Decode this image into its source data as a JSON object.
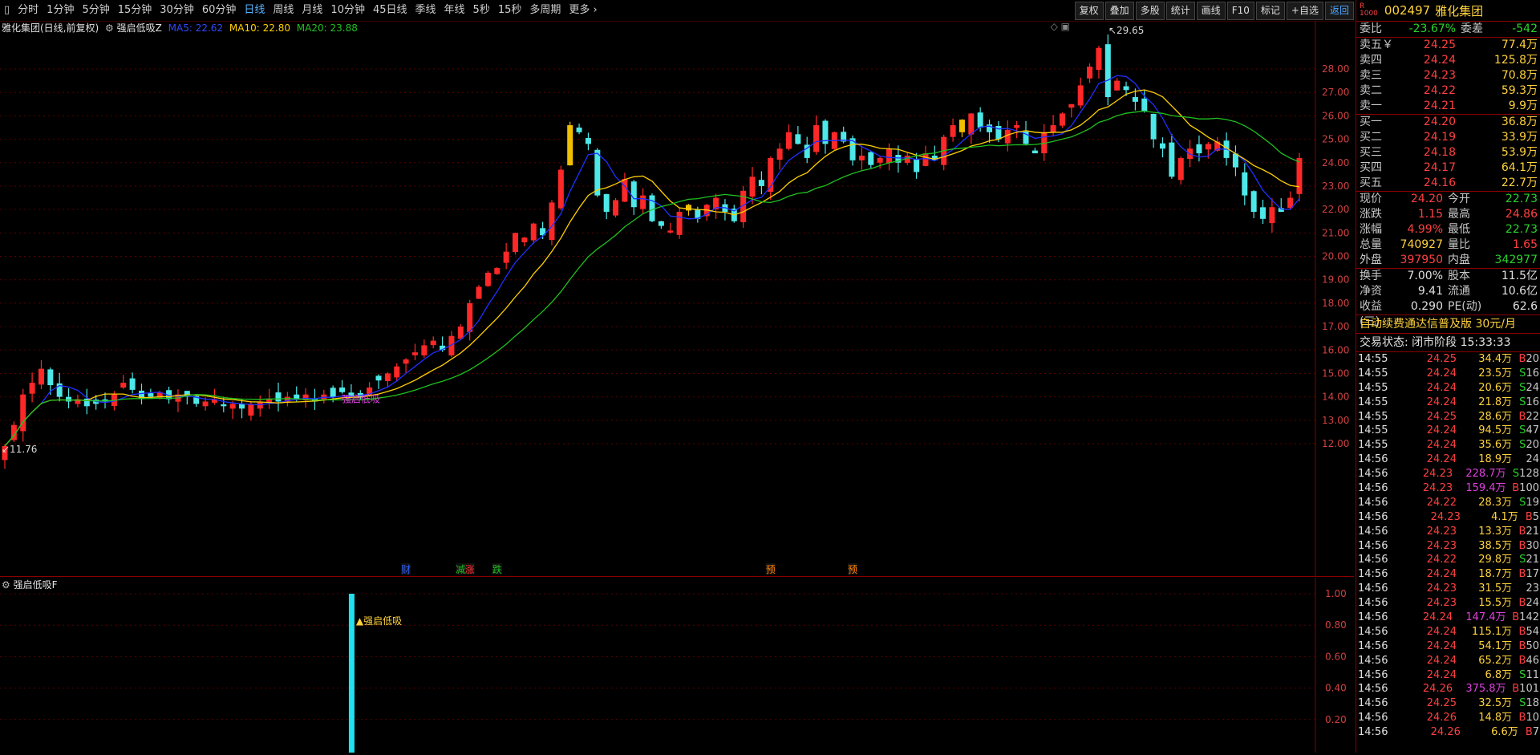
{
  "toolbar": {
    "periods": [
      "分时",
      "1分钟",
      "5分钟",
      "15分钟",
      "30分钟",
      "60分钟",
      "日线",
      "周线",
      "月线",
      "10分钟",
      "45日线",
      "季线",
      "年线",
      "5秒",
      "15秒",
      "多周期",
      "更多"
    ],
    "active_period": "日线",
    "right_buttons": [
      "复权",
      "叠加",
      "多股",
      "统计",
      "画线",
      "F10",
      "标记",
      "+自选",
      "返回"
    ]
  },
  "main_chart": {
    "header_title": "雅化集团(日线,前复权)",
    "indicator_name": "强启低吸Z",
    "ma5_label": "MA5: 22.62",
    "ma10_label": "MA10: 22.80",
    "ma20_label": "MA20: 23.88",
    "high_label": "29.65",
    "low_label": "11.76",
    "signal_text": "强启低吸",
    "event_markers": [
      "财",
      "减",
      "涨",
      "跌",
      "预",
      "预"
    ],
    "y_ticks": [
      "28.00",
      "27.00",
      "26.00",
      "25.00",
      "24.00",
      "23.00",
      "22.00",
      "21.00",
      "20.00",
      "19.00",
      "18.00",
      "17.00",
      "16.00",
      "15.00",
      "14.00",
      "13.00",
      "12.00"
    ]
  },
  "indicator_panel": {
    "title": "强启低吸F",
    "signal_label": "强启低吸",
    "y_ticks": [
      "1.00",
      "0.80",
      "0.60",
      "0.40",
      "0.20"
    ]
  },
  "chart_data": {
    "type": "candlestick",
    "title": "雅化集团(日线,前复权)",
    "ylim": [
      11,
      30
    ],
    "ma_series": [
      {
        "name": "MA5",
        "value": 22.62,
        "color": "#2030ff"
      },
      {
        "name": "MA10",
        "value": 22.8,
        "color": "#ffd000"
      },
      {
        "name": "MA20",
        "value": 23.88,
        "color": "#20c020"
      }
    ],
    "closes": [
      11.9,
      12.8,
      14.1,
      14.6,
      15.2,
      14.5,
      14.0,
      13.8,
      13.9,
      13.6,
      13.7,
      13.8,
      14.1,
      14.6,
      14.3,
      13.9,
      14.0,
      14.2,
      13.9,
      14.1,
      14.0,
      13.7,
      13.8,
      13.9,
      13.6,
      13.7,
      13.5,
      13.7,
      13.8,
      13.9,
      13.8,
      14.0,
      13.9,
      14.1,
      13.8,
      14.1,
      14.0,
      14.2,
      14.0,
      14.0,
      14.4,
      14.7,
      15.0,
      15.3,
      15.6,
      15.9,
      16.2,
      16.4,
      16.0,
      16.6,
      17.0,
      18.0,
      18.7,
      19.3,
      19.5,
      20.2,
      21.0,
      20.8,
      21.4,
      20.9,
      22.3,
      23.7,
      25.6,
      25.3,
      24.8,
      22.6,
      21.9,
      22.4,
      23.3,
      22.1,
      22.6,
      21.5,
      21.3,
      21.1,
      21.9,
      22.2,
      21.6,
      22.2,
      22.5,
      21.9,
      21.5,
      22.8,
      23.4,
      23.0,
      24.2,
      24.6,
      25.3,
      24.8,
      24.2,
      25.6,
      24.8,
      25.3,
      24.9,
      24.1,
      24.3,
      23.9,
      24.2,
      24.6,
      24.0,
      24.3,
      23.6,
      24.4,
      24.1,
      25.1,
      25.6,
      25.3,
      26.1,
      25.5,
      25.3,
      25.0,
      25.4,
      25.6,
      24.8,
      24.4,
      25.3,
      25.6,
      26.1,
      26.5,
      27.3,
      28.1,
      28.9,
      26.8,
      27.5,
      27.1,
      26.6,
      26.2,
      25.0,
      24.6,
      23.4,
      24.2,
      24.6,
      24.4,
      24.8,
      24.9,
      24.2,
      23.8,
      22.6,
      21.9,
      21.6,
      22.1,
      21.9,
      22.5,
      24.2
    ],
    "y_ticks": [
      28,
      27,
      26,
      25,
      24,
      23,
      22,
      21,
      20,
      19,
      18,
      17,
      16,
      15,
      14,
      13,
      12
    ]
  },
  "quote": {
    "code": "002497",
    "name": "雅化集团",
    "ratio_label": "委比",
    "ratio_value": "-23.67%",
    "diff_label": "委差",
    "diff_value": "-542",
    "asks": [
      {
        "label": "卖五￥",
        "price": "24.25",
        "vol": "77.4万"
      },
      {
        "label": "卖四",
        "price": "24.24",
        "vol": "125.8万"
      },
      {
        "label": "卖三",
        "price": "24.23",
        "vol": "70.8万"
      },
      {
        "label": "卖二",
        "price": "24.22",
        "vol": "59.3万"
      },
      {
        "label": "卖一",
        "price": "24.21",
        "vol": "9.9万"
      }
    ],
    "bids": [
      {
        "label": "买一",
        "price": "24.20",
        "vol": "36.8万"
      },
      {
        "label": "买二",
        "price": "24.19",
        "vol": "33.9万"
      },
      {
        "label": "买三",
        "price": "24.18",
        "vol": "53.9万"
      },
      {
        "label": "买四",
        "price": "24.17",
        "vol": "64.1万"
      },
      {
        "label": "买五",
        "price": "24.16",
        "vol": "22.7万"
      }
    ],
    "stats1": [
      {
        "l1": "现价",
        "v1": "24.20",
        "c1": "red",
        "l2": "今开",
        "v2": "22.73",
        "c2": "green"
      },
      {
        "l1": "涨跌",
        "v1": "1.15",
        "c1": "red",
        "l2": "最高",
        "v2": "24.86",
        "c2": "red"
      },
      {
        "l1": "涨幅",
        "v1": "4.99%",
        "c1": "red",
        "l2": "最低",
        "v2": "22.73",
        "c2": "green"
      },
      {
        "l1": "总量",
        "v1": "740927",
        "c1": "yellow",
        "l2": "量比",
        "v2": "1.65",
        "c2": "red"
      },
      {
        "l1": "外盘",
        "v1": "397950",
        "c1": "red",
        "l2": "内盘",
        "v2": "342977",
        "c2": "green"
      }
    ],
    "stats2": [
      {
        "l1": "换手",
        "v1": "7.00%",
        "c1": "white",
        "l2": "股本",
        "v2": "11.5亿",
        "c2": "white"
      },
      {
        "l1": "净资",
        "v1": "9.41",
        "c1": "white",
        "l2": "流通",
        "v2": "10.6亿",
        "c2": "white"
      },
      {
        "l1": "收益(三)",
        "v1": "0.290",
        "c1": "white",
        "l2": "PE(动)",
        "v2": "62.6",
        "c2": "white"
      }
    ],
    "ad_text": "自动续费通达信普及版  30元/月",
    "trade_state": "交易状态: 闭市阶段 15:33:33"
  },
  "ticks": [
    {
      "time": "14:55",
      "price": "24.25",
      "vol": "34.4万",
      "bs": "B",
      "cnt": "20",
      "pc": "red",
      "vc": "yellow"
    },
    {
      "time": "14:55",
      "price": "24.24",
      "vol": "23.5万",
      "bs": "S",
      "cnt": "16",
      "pc": "red",
      "vc": "yellow"
    },
    {
      "time": "14:55",
      "price": "24.24",
      "vol": "20.6万",
      "bs": "S",
      "cnt": "24",
      "pc": "red",
      "vc": "yellow"
    },
    {
      "time": "14:55",
      "price": "24.24",
      "vol": "21.8万",
      "bs": "S",
      "cnt": "16",
      "pc": "red",
      "vc": "yellow"
    },
    {
      "time": "14:55",
      "price": "24.25",
      "vol": "28.6万",
      "bs": "B",
      "cnt": "22",
      "pc": "red",
      "vc": "yellow"
    },
    {
      "time": "14:55",
      "price": "24.24",
      "vol": "94.5万",
      "bs": "S",
      "cnt": "47",
      "pc": "red",
      "vc": "yellow"
    },
    {
      "time": "14:55",
      "price": "24.24",
      "vol": "35.6万",
      "bs": "S",
      "cnt": "20",
      "pc": "red",
      "vc": "yellow"
    },
    {
      "time": "14:56",
      "price": "24.24",
      "vol": "18.9万",
      "bs": "",
      "cnt": "24",
      "pc": "red",
      "vc": "yellow"
    },
    {
      "time": "14:56",
      "price": "24.23",
      "vol": "228.7万",
      "bs": "S",
      "cnt": "128",
      "pc": "red",
      "vc": "mag"
    },
    {
      "time": "14:56",
      "price": "24.23",
      "vol": "159.4万",
      "bs": "B",
      "cnt": "100",
      "pc": "red",
      "vc": "mag"
    },
    {
      "time": "14:56",
      "price": "24.22",
      "vol": "28.3万",
      "bs": "S",
      "cnt": "19",
      "pc": "red",
      "vc": "yellow"
    },
    {
      "time": "14:56",
      "price": "24.23",
      "vol": "4.1万",
      "bs": "B",
      "cnt": "5",
      "pc": "red",
      "vc": "yellow"
    },
    {
      "time": "14:56",
      "price": "24.23",
      "vol": "13.3万",
      "bs": "B",
      "cnt": "21",
      "pc": "red",
      "vc": "yellow"
    },
    {
      "time": "14:56",
      "price": "24.23",
      "vol": "38.5万",
      "bs": "B",
      "cnt": "30",
      "pc": "red",
      "vc": "yellow"
    },
    {
      "time": "14:56",
      "price": "24.22",
      "vol": "29.8万",
      "bs": "S",
      "cnt": "21",
      "pc": "red",
      "vc": "yellow"
    },
    {
      "time": "14:56",
      "price": "24.24",
      "vol": "18.7万",
      "bs": "B",
      "cnt": "17",
      "pc": "red",
      "vc": "yellow"
    },
    {
      "time": "14:56",
      "price": "24.23",
      "vol": "31.5万",
      "bs": "",
      "cnt": "23",
      "pc": "red",
      "vc": "yellow"
    },
    {
      "time": "14:56",
      "price": "24.23",
      "vol": "15.5万",
      "bs": "B",
      "cnt": "24",
      "pc": "red",
      "vc": "yellow"
    },
    {
      "time": "14:56",
      "price": "24.24",
      "vol": "147.4万",
      "bs": "B",
      "cnt": "142",
      "pc": "red",
      "vc": "mag"
    },
    {
      "time": "14:56",
      "price": "24.24",
      "vol": "115.1万",
      "bs": "B",
      "cnt": "54",
      "pc": "red",
      "vc": "yellow"
    },
    {
      "time": "14:56",
      "price": "24.24",
      "vol": "54.1万",
      "bs": "B",
      "cnt": "50",
      "pc": "red",
      "vc": "yellow"
    },
    {
      "time": "14:56",
      "price": "24.24",
      "vol": "65.2万",
      "bs": "B",
      "cnt": "46",
      "pc": "red",
      "vc": "yellow"
    },
    {
      "time": "14:56",
      "price": "24.24",
      "vol": "6.8万",
      "bs": "S",
      "cnt": "11",
      "pc": "red",
      "vc": "yellow"
    },
    {
      "time": "14:56",
      "price": "24.26",
      "vol": "375.8万",
      "bs": "B",
      "cnt": "101",
      "pc": "red",
      "vc": "mag"
    },
    {
      "time": "14:56",
      "price": "24.25",
      "vol": "32.5万",
      "bs": "S",
      "cnt": "18",
      "pc": "red",
      "vc": "yellow"
    },
    {
      "time": "14:56",
      "price": "24.26",
      "vol": "14.8万",
      "bs": "B",
      "cnt": "10",
      "pc": "red",
      "vc": "yellow"
    },
    {
      "time": "14:56",
      "price": "24.26",
      "vol": "6.6万",
      "bs": "B",
      "cnt": "7",
      "pc": "red",
      "vc": "yellow"
    }
  ]
}
